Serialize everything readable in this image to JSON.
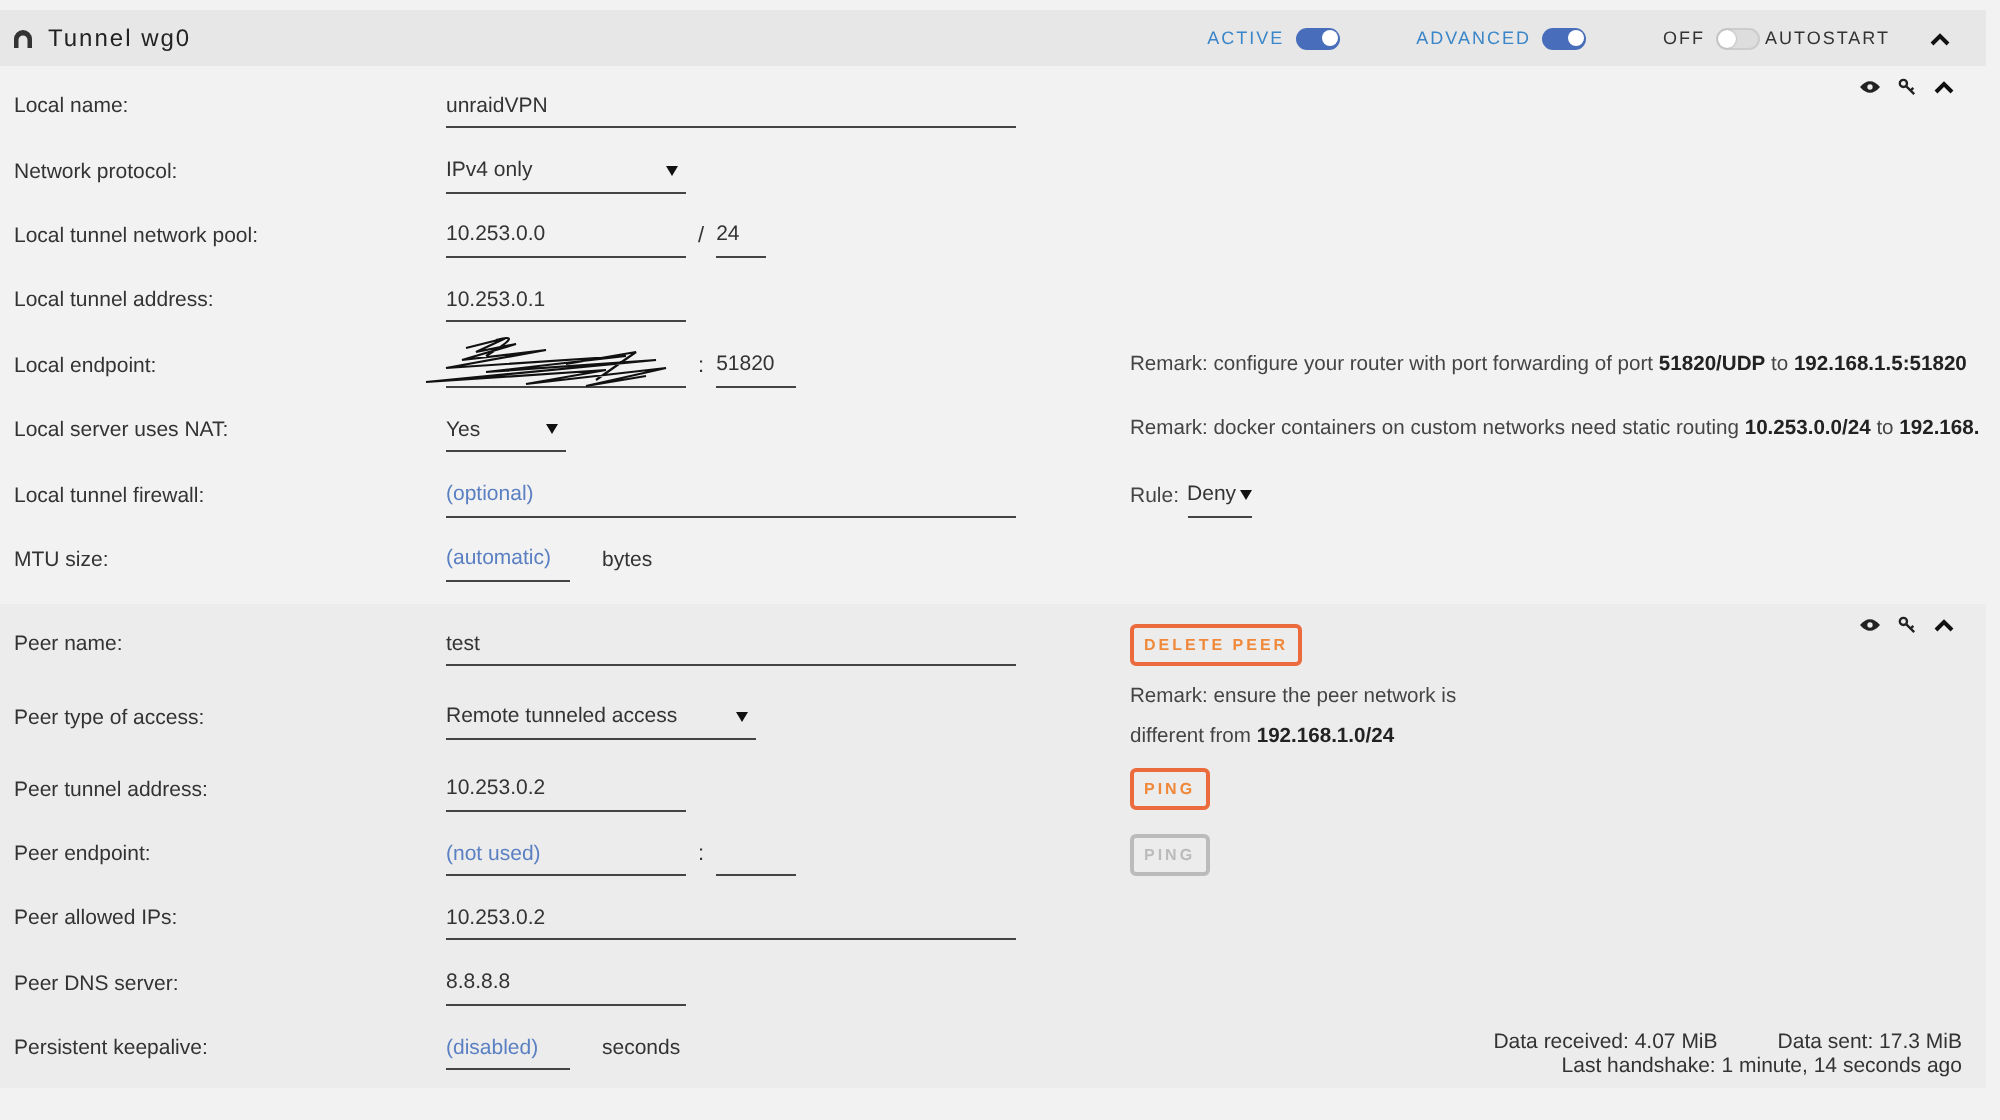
{
  "header": {
    "title": "Tunnel wg0",
    "toggles": [
      {
        "label": "ACTIVE",
        "on": true
      },
      {
        "label": "ADVANCED",
        "on": true
      },
      {
        "label": "OFF",
        "suffix": "AUTOSTART",
        "on": false
      }
    ]
  },
  "sections": [
    {
      "kind": "tunnel",
      "rows": [
        {
          "label": "Local name:",
          "inputs": [
            {
              "kind": "text",
              "value": "unraidVPN"
            }
          ]
        },
        {
          "label": "Network protocol:",
          "inputs": [
            {
              "kind": "select",
              "value": "IPv4 only"
            }
          ]
        },
        {
          "label": "Local tunnel network pool:",
          "inputs": [
            {
              "kind": "text",
              "value": "10.253.0.0"
            },
            {
              "kind": "sep",
              "text": "/"
            },
            {
              "kind": "text",
              "value": "24"
            }
          ]
        },
        {
          "label": "Local tunnel address:",
          "inputs": [
            {
              "kind": "text",
              "value": "10.253.0.1"
            }
          ]
        },
        {
          "label": "Local endpoint:",
          "inputs": [
            {
              "kind": "redacted"
            },
            {
              "kind": "sep",
              "text": ":"
            },
            {
              "kind": "text",
              "value": "51820"
            }
          ],
          "side": {
            "kind": "remark",
            "text": "Remark: configure your router with port forwarding of port **51820/UDP** to **192.168.1.5:51820**"
          }
        },
        {
          "label": "Local server uses NAT:",
          "inputs": [
            {
              "kind": "select",
              "value": "Yes"
            }
          ],
          "side": {
            "kind": "remark",
            "text": "Remark: docker containers on custom networks need static routing **10.253.0.0/24** to **192.168.**"
          }
        },
        {
          "label": "Local tunnel firewall:",
          "inputs": [
            {
              "kind": "text",
              "placeholder": "(optional)"
            }
          ],
          "side": {
            "kind": "select",
            "label": "Rule:",
            "value": "Deny"
          }
        },
        {
          "label": "MTU size:",
          "inputs": [
            {
              "kind": "text",
              "placeholder": "(automatic)"
            },
            {
              "kind": "unit",
              "text": "bytes"
            }
          ]
        }
      ]
    },
    {
      "kind": "peer",
      "rows": [
        {
          "label": "Peer name:",
          "inputs": [
            {
              "kind": "text",
              "value": "test"
            }
          ],
          "side": {
            "kind": "button",
            "label": "DELETE PEER",
            "disabled": false
          }
        },
        {
          "label": "Peer type of access:",
          "inputs": [
            {
              "kind": "select",
              "value": "Remote tunneled access"
            }
          ],
          "side": {
            "kind": "remark",
            "text": "Remark: ensure the peer network is\ndifferent from **192.168.1.0/24**"
          }
        },
        {
          "label": "Peer tunnel address:",
          "inputs": [
            {
              "kind": "text",
              "value": "10.253.0.2"
            }
          ],
          "side": {
            "kind": "button",
            "label": "PING",
            "disabled": false
          }
        },
        {
          "label": "Peer endpoint:",
          "inputs": [
            {
              "kind": "text",
              "placeholder": "(not used)"
            },
            {
              "kind": "sep",
              "text": ":"
            },
            {
              "kind": "text"
            }
          ],
          "side": {
            "kind": "button",
            "label": "PING",
            "disabled": true
          }
        },
        {
          "label": "Peer allowed IPs:",
          "inputs": [
            {
              "kind": "text",
              "value": "10.253.0.2"
            }
          ]
        },
        {
          "label": "Peer DNS server:",
          "inputs": [
            {
              "kind": "text",
              "value": "8.8.8.8"
            }
          ]
        },
        {
          "label": "Persistent keepalive:",
          "inputs": [
            {
              "kind": "text",
              "placeholder": "(disabled)"
            },
            {
              "kind": "unit",
              "text": "seconds"
            }
          ],
          "side": {
            "kind": "stats",
            "lines": [
              [
                "Data received: 4.07 MiB",
                "Data sent: 17.3 MiB"
              ],
              [
                "Last handshake: 1 minute, 14 seconds ago"
              ]
            ]
          }
        }
      ]
    }
  ]
}
